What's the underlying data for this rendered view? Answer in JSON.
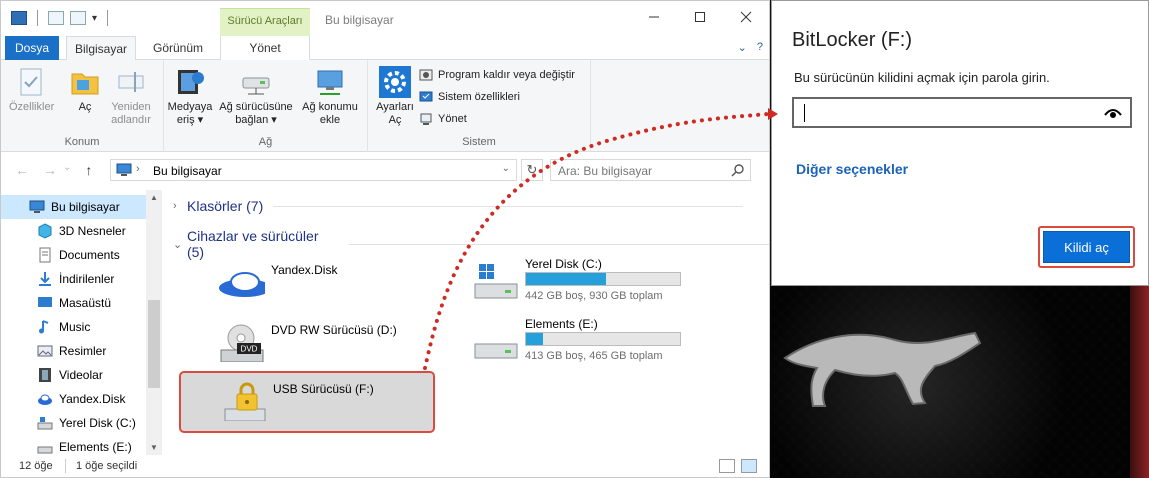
{
  "explorer": {
    "context_tab_header": "Sürücü Araçları",
    "window_title": "Bu bilgisayar",
    "tabs": {
      "file": "Dosya",
      "computer": "Bilgisayar",
      "view": "Görünüm",
      "manage": "Yönet"
    },
    "ribbon": {
      "location_group": "Konum",
      "properties": "Özellikler",
      "open": "Aç",
      "rename_1": "Yeniden",
      "rename_2": "adlandır",
      "network_group": "Ağ",
      "media_1": "Medyaya",
      "media_2": "eriş",
      "map_drive_1": "Ağ sürücüsüne",
      "map_drive_2": "bağlan",
      "add_location_1": "Ağ konumu",
      "add_location_2": "ekle",
      "system_group": "Sistem",
      "settings_1": "Ayarları",
      "settings_2": "Aç",
      "uninstall": "Program kaldır veya değiştir",
      "system_props": "Sistem özellikleri",
      "manage": "Yönet"
    },
    "address": {
      "path": "Bu bilgisayar",
      "search_placeholder": "Ara: Bu bilgisayar"
    },
    "nav": {
      "root": "Bu bilgisayar",
      "items": [
        "3D Nesneler",
        "Documents",
        "İndirilenler",
        "Masaüstü",
        "Music",
        "Resimler",
        "Videolar",
        "Yandex.Disk",
        "Yerel Disk (C:)",
        "Elements (E:)"
      ]
    },
    "content": {
      "folders_header": "Klasörler (7)",
      "devices_header": "Cihazlar ve sürücüler (5)",
      "yandex": "Yandex.Disk",
      "dvd": "DVD RW Sürücüsü (D:)",
      "dvd_label": "DVD",
      "usb": "USB Sürücüsü (F:)",
      "c_name": "Yerel Disk (C:)",
      "c_size": "442 GB boş, 930 GB toplam",
      "c_used": 0.52,
      "e_name": "Elements (E:)",
      "e_size": "413 GB boş, 465 GB toplam",
      "e_used": 0.11
    },
    "status": {
      "count": "12 öğe",
      "selected": "1 öğe seçildi"
    }
  },
  "bitlocker": {
    "title": "BitLocker (F:)",
    "prompt": "Bu sürücünün kilidini açmak için parola girin.",
    "password_value": "",
    "more_options": "Diğer seçenekler",
    "unlock": "Kilidi aç"
  },
  "colors": {
    "accent": "#0a6fd6",
    "highlight": "#d94b3f",
    "selection": "#cce8ff",
    "bar_fill": "#26a0da",
    "file_tab": "#1a6fc6"
  }
}
